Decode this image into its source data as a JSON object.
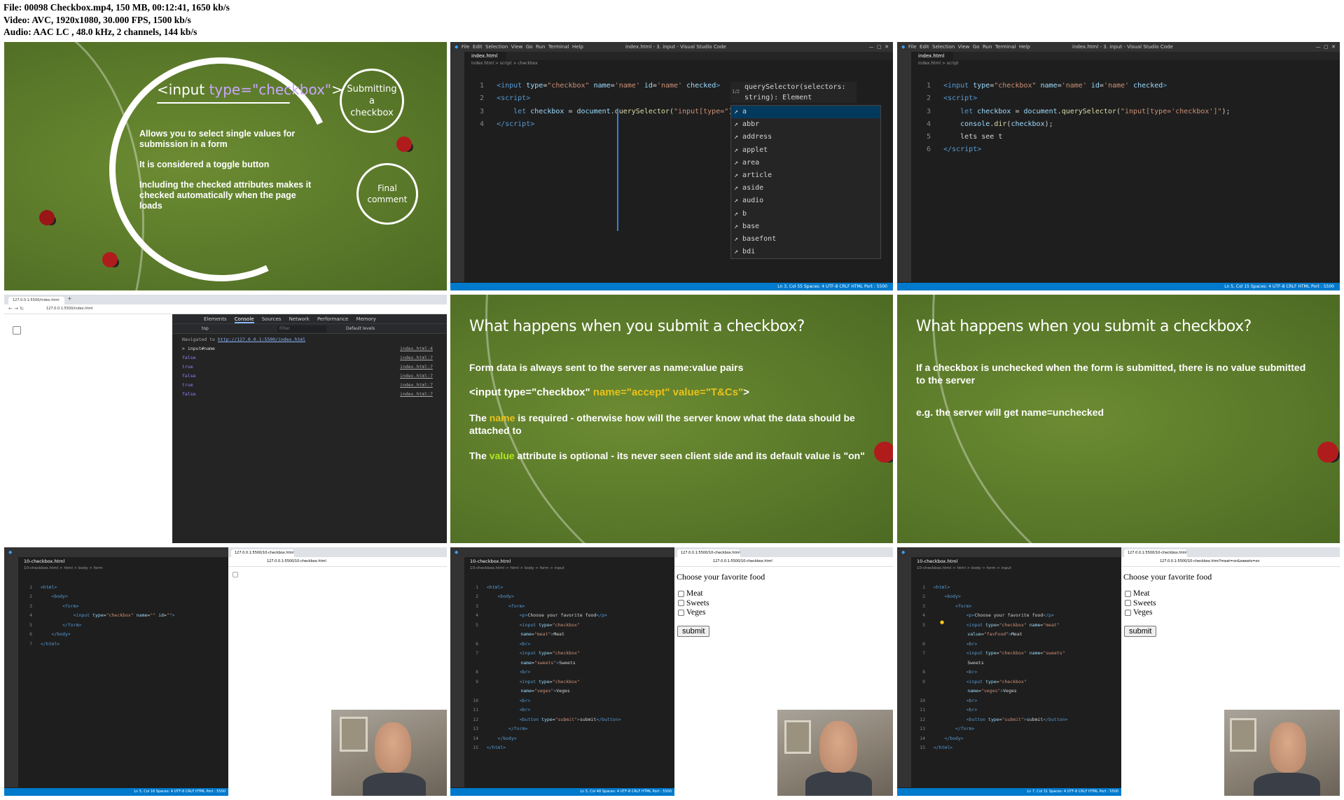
{
  "header": {
    "line1": "File: 00098 Checkbox.mp4, 150 MB, 00:12:41, 1650 kb/s",
    "line2": "Video: AVC, 1920x1080, 30.000 FPS, 1500 kb/s",
    "line3": "Audio: AAC LC , 48.0 kHz, 2 channels, 144 kb/s"
  },
  "slide1": {
    "title_prefix": "<input ",
    "title_attr": "type=\"checkbox\"",
    "title_suffix": ">",
    "bullets": [
      "Allows you to select single values for submission in a form",
      "It is considered a toggle button",
      "Including the checked attributes makes it checked automatically when the page loads"
    ],
    "bubble1": "Submitting a checkbox",
    "bubble2": "Final comment"
  },
  "editor1": {
    "title": "index.html - 3. input - Visual Studio Code",
    "menu": [
      "File",
      "Edit",
      "Selection",
      "View",
      "Go",
      "Run",
      "Terminal",
      "Help"
    ],
    "tab": "index.html",
    "breadcrumb": "index.html > script > checkbox",
    "lines": [
      "1",
      "2",
      "3",
      "4"
    ],
    "suggest_hint_a": "querySelector(selectors:",
    "suggest_hint_b": "string): Element",
    "suggest_counter": "1/2",
    "suggestions": [
      "a",
      "abbr",
      "address",
      "applet",
      "area",
      "article",
      "aside",
      "audio",
      "b",
      "base",
      "basefont",
      "bdi"
    ],
    "status": "Ln 3, Col 55   Spaces: 4   UTF-8   CRLF   HTML   Port : 5500"
  },
  "editor2": {
    "title": "index.html - 3. input - Visual Studio Code",
    "tab": "index.html",
    "breadcrumb": "index.html > script",
    "lines": [
      "1",
      "2",
      "3",
      "4",
      "5",
      "6"
    ],
    "line5": "lets see t",
    "status": "Ln 5, Col 15   Spaces: 4   UTF-8   CRLF   HTML   Port : 5500"
  },
  "devtools": {
    "url": "127.0.0.1:5500/index.html",
    "tabs": [
      "Elements",
      "Console",
      "Sources",
      "Network",
      "Performance",
      "Memory"
    ],
    "context": "top",
    "filter": "Filter",
    "levels": "Default levels",
    "navigated_prefix": "Navigated to ",
    "navigated_url": "http://127.0.0.1:5500/index.html",
    "rows": [
      {
        "text": "> input#name",
        "src": "index.html:4"
      },
      {
        "text": "false",
        "src": "index.html:7"
      },
      {
        "text": "true",
        "src": "index.html:7"
      },
      {
        "text": "false",
        "src": "index.html:7"
      },
      {
        "text": "true",
        "src": "index.html:7"
      },
      {
        "text": "false",
        "src": "index.html:7"
      }
    ]
  },
  "slide2": {
    "heading": "What happens when you submit a checkbox?",
    "p1": "Form data is always sent to the server as name:value pairs",
    "code_a": "<input type=\"checkbox\" ",
    "code_b": "name=\"accept\"",
    "code_c": " value=\"T&Cs\"",
    "code_d": ">",
    "p2_a": "The ",
    "p2_b": "name",
    "p2_c": " is required - otherwise how will the server know what the data should be attached to",
    "p3_a": "The ",
    "p3_b": "value",
    "p3_c": " attribute is optional - its never seen client side and its default value is \"on\""
  },
  "slide3": {
    "heading": "What happens when you submit a checkbox?",
    "p1": "If a checkbox is unchecked when the form is submitted, there is no value submitted to the server",
    "p2": "e.g. the server will get name=unchecked"
  },
  "tile7": {
    "tab": "10-checkbox.html",
    "breadcrumb": "10-checkbox.html > html > body > form",
    "lines": [
      "1",
      "2",
      "3",
      "4",
      "5",
      "6",
      "7"
    ],
    "url": "127.0.0.1:5500/10-checkbox.html",
    "status": "Ln 5, Col 16   Spaces: 4   UTF-8   CRLF   HTML   Port : 5500"
  },
  "tile8": {
    "tab": "10-checkbox.html",
    "breadcrumb": "10-checkbox.html > html > body > form > input",
    "lines": [
      "1",
      "2",
      "3",
      "4",
      "5",
      "6",
      "7",
      "8",
      "9",
      "10",
      "11",
      "12",
      "13",
      "14",
      "15"
    ],
    "url": "127.0.0.1:5500/10-checkbox.html",
    "form_title": "Choose your favorite food",
    "options": [
      "Meat",
      "Sweets",
      "Veges"
    ],
    "submit": "submit",
    "status": "Ln 5, Col 48   Spaces: 4   UTF-8   CRLF   HTML   Port : 5500"
  },
  "tile9": {
    "tab": "10-checkbox.html",
    "breadcrumb": "10-checkbox.html > html > body > form > input",
    "lines": [
      "1",
      "2",
      "3",
      "4",
      "5",
      "6",
      "7",
      "8",
      "9",
      "10",
      "11",
      "12",
      "13",
      "14",
      "15"
    ],
    "url": "127.0.0.1:5500/10-checkbox.html?meat=on&sweets=on",
    "form_title": "Choose your favorite food",
    "options": [
      "Meat",
      "Sweets",
      "Veges"
    ],
    "submit": "submit",
    "status": "Ln 7, Col 31   Spaces: 4   UTF-8   CRLF   HTML   Port : 5500"
  }
}
